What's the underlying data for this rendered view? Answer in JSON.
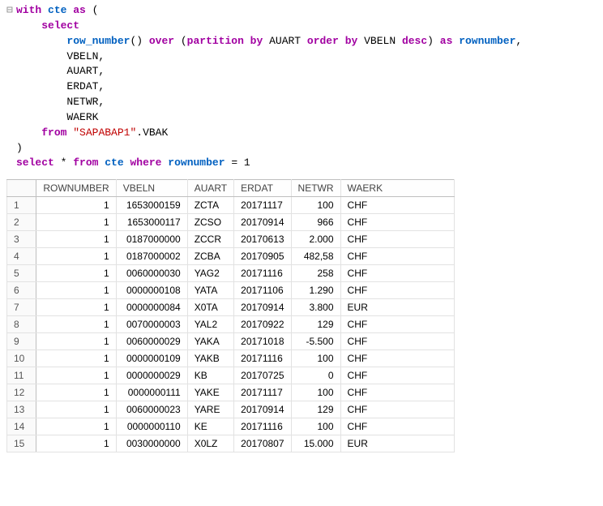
{
  "sql": {
    "lines": [
      {
        "fold": "⊟",
        "tokens": [
          [
            "kw",
            "with"
          ],
          [
            "pl",
            " "
          ],
          [
            "fn",
            "cte"
          ],
          [
            "pl",
            " "
          ],
          [
            "kw",
            "as"
          ],
          [
            "pl",
            " ("
          ]
        ]
      },
      {
        "indent": "    ",
        "tokens": [
          [
            "kw",
            "select"
          ]
        ]
      },
      {
        "indent": "        ",
        "tokens": [
          [
            "fn",
            "row_number"
          ],
          [
            "pl",
            "() "
          ],
          [
            "kw",
            "over"
          ],
          [
            "pl",
            " ("
          ],
          [
            "kw",
            "partition by"
          ],
          [
            "pl",
            " AUART "
          ],
          [
            "kw",
            "order by"
          ],
          [
            "pl",
            " VBELN "
          ],
          [
            "kw",
            "desc"
          ],
          [
            "pl",
            ") "
          ],
          [
            "as",
            "as"
          ],
          [
            "pl",
            " "
          ],
          [
            "fn",
            "rownumber"
          ],
          [
            "pl",
            ","
          ]
        ]
      },
      {
        "indent": "        ",
        "tokens": [
          [
            "pl",
            "VBELN,"
          ]
        ]
      },
      {
        "indent": "        ",
        "tokens": [
          [
            "pl",
            "AUART,"
          ]
        ]
      },
      {
        "indent": "        ",
        "tokens": [
          [
            "pl",
            "ERDAT,"
          ]
        ]
      },
      {
        "indent": "        ",
        "tokens": [
          [
            "pl",
            "NETWR,"
          ]
        ]
      },
      {
        "indent": "        ",
        "tokens": [
          [
            "pl",
            "WAERK"
          ]
        ]
      },
      {
        "indent": "    ",
        "tokens": [
          [
            "kw",
            "from"
          ],
          [
            "pl",
            " "
          ],
          [
            "str",
            "\"SAPABAP1\""
          ],
          [
            "pl",
            ".VBAK"
          ]
        ]
      },
      {
        "indent": "",
        "tokens": [
          [
            "pl",
            ")"
          ]
        ]
      },
      {
        "indent": "",
        "tokens": [
          [
            "kw",
            "select"
          ],
          [
            "pl",
            " * "
          ],
          [
            "kw",
            "from"
          ],
          [
            "pl",
            " "
          ],
          [
            "fn",
            "cte"
          ],
          [
            "pl",
            " "
          ],
          [
            "kw",
            "where"
          ],
          [
            "pl",
            " "
          ],
          [
            "fn",
            "rownumber"
          ],
          [
            "pl",
            " = 1"
          ]
        ]
      }
    ]
  },
  "result": {
    "columns": [
      "ROWNUMBER",
      "VBELN",
      "AUART",
      "ERDAT",
      "NETWR",
      "WAERK"
    ],
    "col_class": [
      "col-rownumber",
      "col-vbeln",
      "col-auart",
      "col-erdat",
      "col-netwr",
      "col-waerk"
    ],
    "align": [
      "num",
      "num",
      "txt",
      "txt",
      "num",
      "txt"
    ],
    "rows": [
      [
        "1",
        "1653000159",
        "ZCTA",
        "20171117",
        "100",
        "CHF"
      ],
      [
        "1",
        "1653000117",
        "ZCSO",
        "20170914",
        "966",
        "CHF"
      ],
      [
        "1",
        "0187000000",
        "ZCCR",
        "20170613",
        "2.000",
        "CHF"
      ],
      [
        "1",
        "0187000002",
        "ZCBA",
        "20170905",
        "482,58",
        "CHF"
      ],
      [
        "1",
        "0060000030",
        "YAG2",
        "20171116",
        "258",
        "CHF"
      ],
      [
        "1",
        "0000000108",
        "YATA",
        "20171106",
        "1.290",
        "CHF"
      ],
      [
        "1",
        "0000000084",
        "X0TA",
        "20170914",
        "3.800",
        "EUR"
      ],
      [
        "1",
        "0070000003",
        "YAL2",
        "20170922",
        "129",
        "CHF"
      ],
      [
        "1",
        "0060000029",
        "YAKA",
        "20171018",
        "-5.500",
        "CHF"
      ],
      [
        "1",
        "0000000109",
        "YAKB",
        "20171116",
        "100",
        "CHF"
      ],
      [
        "1",
        "0000000029",
        "KB",
        "20170725",
        "0",
        "CHF"
      ],
      [
        "1",
        "0000000111",
        "YAKE",
        "20171117",
        "100",
        "CHF"
      ],
      [
        "1",
        "0060000023",
        "YARE",
        "20170914",
        "129",
        "CHF"
      ],
      [
        "1",
        "0000000110",
        "KE",
        "20171116",
        "100",
        "CHF"
      ],
      [
        "1",
        "0030000000",
        "X0LZ",
        "20170807",
        "15.000",
        "EUR"
      ]
    ]
  }
}
